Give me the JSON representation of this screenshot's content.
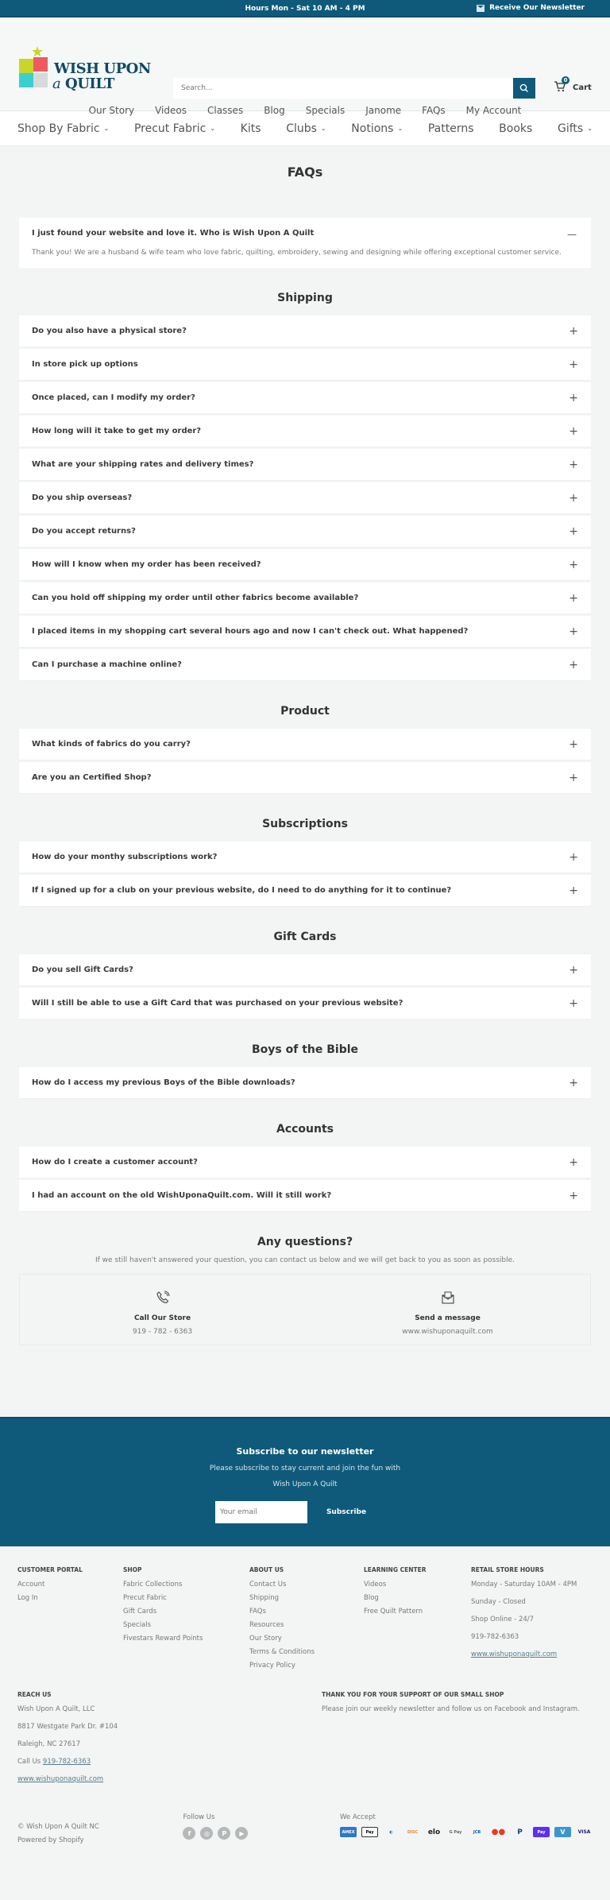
{
  "topbar": {
    "hours": "Hours Mon - Sat 10 AM - 4 PM",
    "newsletter_link": "Receive Our Newsletter"
  },
  "logo": {
    "line1": "WISH UPON",
    "line2_a": "a",
    "line2_b": "QUILT"
  },
  "search": {
    "placeholder": "Search..."
  },
  "cart": {
    "count": "0",
    "label": "Cart"
  },
  "subnav": [
    "Our Story",
    "Videos",
    "Classes",
    "Blog",
    "Specials",
    "Janome",
    "FAQs",
    "My Account"
  ],
  "mainnav": [
    {
      "label": "Shop By Fabric",
      "dropdown": true
    },
    {
      "label": "Precut Fabric",
      "dropdown": true
    },
    {
      "label": "Kits",
      "dropdown": false
    },
    {
      "label": "Clubs",
      "dropdown": true
    },
    {
      "label": "Notions",
      "dropdown": true
    },
    {
      "label": "Patterns",
      "dropdown": false
    },
    {
      "label": "Books",
      "dropdown": false
    },
    {
      "label": "Gifts",
      "dropdown": true
    }
  ],
  "page_title": "FAQs",
  "intro": {
    "question": "I just found your website and love it. Who is Wish Upon A Quilt",
    "answer": "Thank you! We are a husband & wife team who love fabric, quilting, embroidery, sewing and designing while offering exceptional customer service."
  },
  "sections": [
    {
      "title": "Shipping",
      "questions": [
        "Do you also have a physical store?",
        "In store pick up options",
        "Once placed, can I modify my order?",
        "How long will it take to get my order?",
        "What are your shipping rates and delivery times?",
        "Do you ship overseas?",
        "Do you accept returns?",
        "How will I know when my order has been received?",
        "Can you hold off shipping my order until other fabrics become available?",
        "I placed items in my shopping cart several hours ago and now I can't check out. What happened?",
        "Can I purchase a machine online?"
      ]
    },
    {
      "title": "Product",
      "questions": [
        "What kinds of fabrics do you carry?",
        "Are you an Certified Shop?"
      ]
    },
    {
      "title": "Subscriptions",
      "questions": [
        "How do your monthy subscriptions work?",
        "If I signed up for a club on your previous website, do I need to do anything for it to continue?"
      ]
    },
    {
      "title": "Gift Cards",
      "questions": [
        "Do you sell Gift Cards?",
        "Will I still be able to use a Gift Card that was purchased on your previous website?"
      ]
    },
    {
      "title": "Boys of the Bible",
      "questions": [
        "How do I access my previous Boys of the Bible downloads?"
      ]
    },
    {
      "title": "Accounts",
      "questions": [
        "How do I create a customer account?",
        "I had an account on the old WishUponaQuilt.com. Will it still work?"
      ]
    }
  ],
  "questions_block": {
    "title": "Any questions?",
    "text": "If we still haven't answered your question, you can contact us below and we will get back to you as soon as possible.",
    "call": {
      "title": "Call Our Store",
      "value": "919 - 782 - 6363"
    },
    "message": {
      "title": "Send a message",
      "value": "www.wishuponaquilt.com"
    }
  },
  "newsletter": {
    "title": "Subscribe to our newsletter",
    "line1": "Please subscribe to stay current and join the fun with",
    "line2": "Wish Upon A Quilt",
    "placeholder": "Your email",
    "button": "Subscribe"
  },
  "footer": {
    "customer_portal": {
      "title": "CUSTOMER PORTAL",
      "links": [
        "Account",
        "Log In"
      ]
    },
    "shop": {
      "title": "SHOP",
      "links": [
        "Fabric Collections",
        "Precut Fabric",
        "Gift Cards",
        "Specials",
        "Fivestars Reward Points"
      ]
    },
    "about": {
      "title": "ABOUT US",
      "links": [
        "Contact Us",
        "Shipping",
        "FAQs",
        "Resources",
        "Our Story",
        "Terms & Conditions",
        "Privacy Policy"
      ]
    },
    "learning": {
      "title": "LEARNING CENTER",
      "links": [
        "Videos",
        "Blog",
        "Free Quilt Pattern"
      ]
    },
    "hours": {
      "title": "RETAIL STORE HOURS",
      "lines": [
        "Monday - Saturday 10AM - 4PM",
        "Sunday - Closed",
        "Shop Online - 24/7",
        "919-782-6363"
      ],
      "website": "www.wishuponaquilt.com"
    },
    "reach": {
      "title": "REACH US",
      "lines": [
        "Wish Upon A Quilt, LLC",
        "8817 Westgate Park Dr. #104",
        "Raleigh, NC 27617"
      ],
      "call_prefix": "Call Us",
      "phone": "919-782-6363",
      "website": "www.wishuponaquilt.com"
    },
    "thanks": {
      "title": "THANK YOU FOR YOUR SUPPORT OF OUR SMALL SHOP",
      "text": "Please join our weekly newsletter and follow us on Facebook and Instagram."
    },
    "copyright": "© Wish Upon A Quilt NC",
    "powered": "Powered by Shopify",
    "follow": "Follow Us",
    "social": [
      "facebook",
      "instagram",
      "pinterest",
      "youtube"
    ],
    "accept": "We Accept",
    "payments": [
      "American Express",
      "Apple Pay",
      "Diners Club",
      "Discover",
      "Elo",
      "Google Pay",
      "JCB",
      "Mastercard",
      "PayPal",
      "Shop Pay",
      "Venmo",
      "Visa"
    ]
  },
  "colors": {
    "brand": "#0f5a7a",
    "background": "#f3f5f5"
  }
}
